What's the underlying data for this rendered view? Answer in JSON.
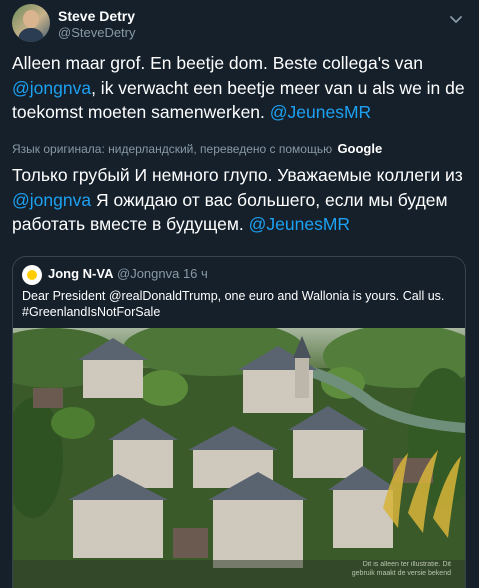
{
  "author": {
    "name": "Steve Detry",
    "handle": "@SteveDetry"
  },
  "tweet": {
    "part1": "Alleen maar grof. En beetje dom. Beste collega's van ",
    "mention1": "@jongnva",
    "part2": ", ik verwacht een beetje meer van u als we in de toekomst moeten samenwerken. ",
    "mention2": "@JeunesMR"
  },
  "translation": {
    "note": "Язык оригинала: нидерландский, переведено с помощью",
    "provider": "Google",
    "part1": "Только грубый И немного глупо. Уважаемые коллеги из ",
    "mention1": "@jongnva",
    "part2": " Я ожидаю от вас большего, если мы будем работать вместе в будущем. ",
    "mention2": "@JeunesMR"
  },
  "quote": {
    "name": "Jong N-VA",
    "handle": "@Jongnva",
    "time": "· 16 ч",
    "line1": "Dear President @realDonaldTrump, one euro and Wallonia is yours. Call us.",
    "line2": "#GreenlandIsNotForSale",
    "watermark1": "Dit is alleen ter illustratie. Dit",
    "watermark2": "ge­bruik maakt de versie bekend"
  },
  "colors": {
    "background": "#15202b",
    "link": "#1da1f2",
    "muted": "#8899a6",
    "border": "#38444d"
  },
  "icons": {
    "menu": "chevron-down-icon"
  }
}
